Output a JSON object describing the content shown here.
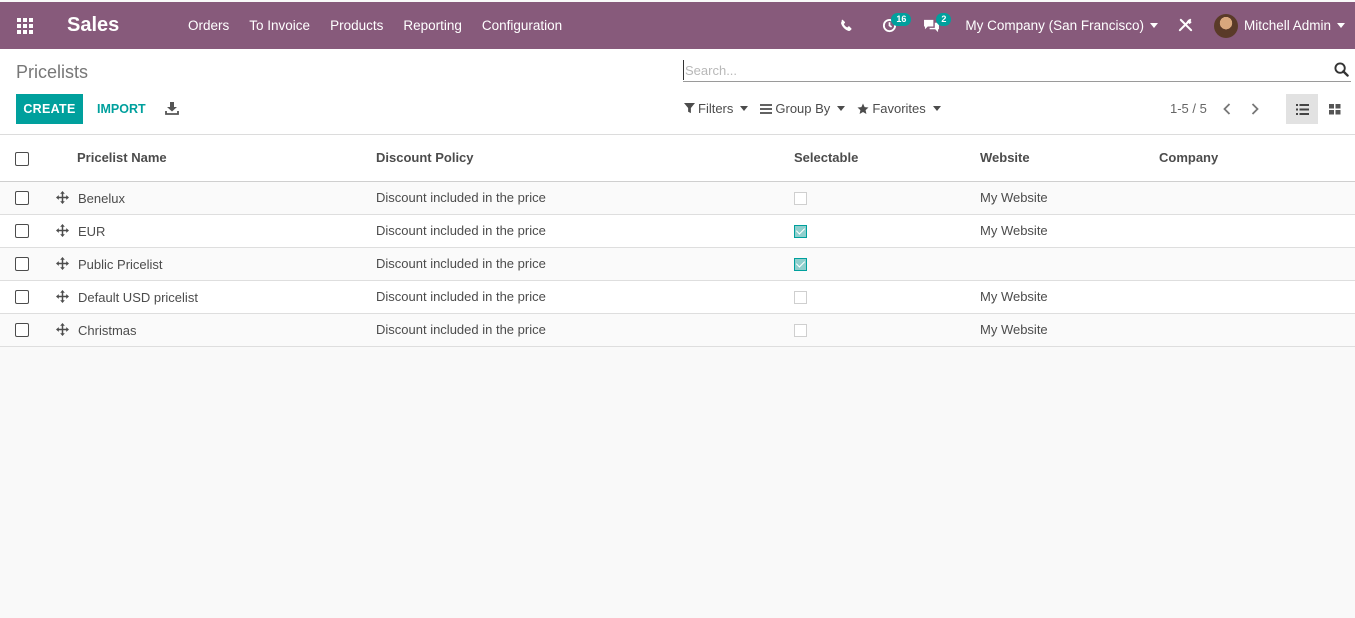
{
  "topbar": {
    "app_name": "Sales",
    "menu": [
      "Orders",
      "To Invoice",
      "Products",
      "Reporting",
      "Configuration"
    ],
    "activity_count": "16",
    "messages_count": "2",
    "company": "My Company (San Francisco)",
    "user": "Mitchell Admin",
    "brand_color": "#875a7b"
  },
  "control_panel": {
    "title": "Pricelists",
    "create_label": "CREATE",
    "import_label": "IMPORT",
    "search_placeholder": "Search...",
    "filters_label": "Filters",
    "group_by_label": "Group By",
    "favorites_label": "Favorites",
    "pager": "1-5 / 5",
    "accent_color": "#00a09d"
  },
  "list": {
    "columns": [
      "Pricelist Name",
      "Discount Policy",
      "Selectable",
      "Website",
      "Company"
    ],
    "rows": [
      {
        "name": "Benelux",
        "policy": "Discount included in the price",
        "selectable": false,
        "website": "My Website",
        "company": ""
      },
      {
        "name": "EUR",
        "policy": "Discount included in the price",
        "selectable": true,
        "website": "My Website",
        "company": ""
      },
      {
        "name": "Public Pricelist",
        "policy": "Discount included in the price",
        "selectable": true,
        "website": "",
        "company": ""
      },
      {
        "name": "Default USD pricelist",
        "policy": "Discount included in the price",
        "selectable": false,
        "website": "My Website",
        "company": ""
      },
      {
        "name": "Christmas",
        "policy": "Discount included in the price",
        "selectable": false,
        "website": "My Website",
        "company": ""
      }
    ]
  }
}
